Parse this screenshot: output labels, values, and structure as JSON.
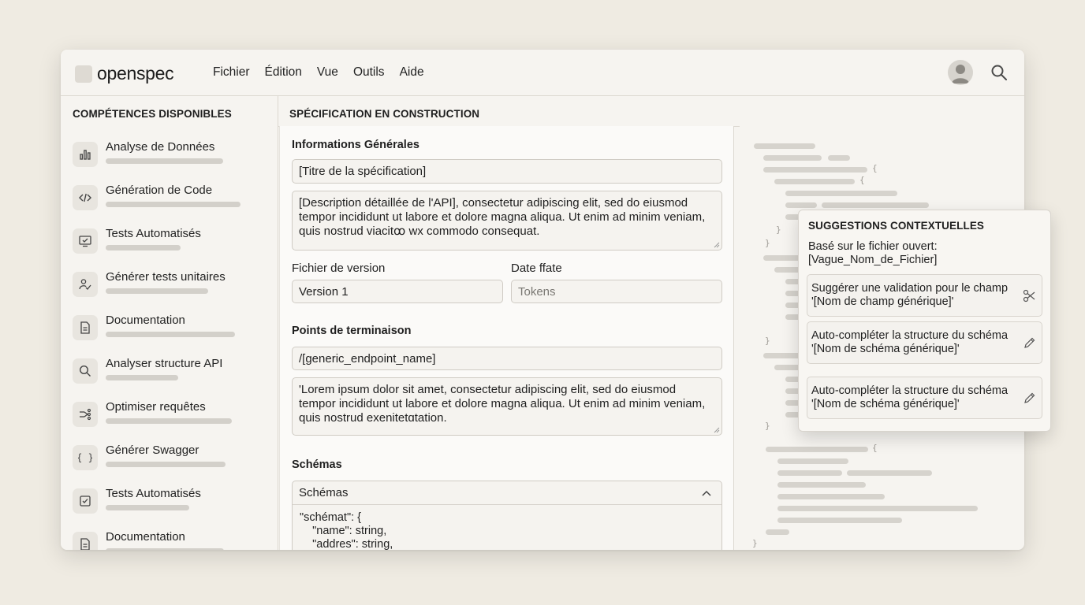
{
  "app": {
    "name": "openspec"
  },
  "menu": [
    "Fichier",
    "Édition",
    "Vue",
    "Outils",
    "Aide"
  ],
  "sidebar": {
    "title": "COMPÉTENCES DISPONIBLES",
    "items": [
      {
        "label": "Analyse de Données",
        "icon": "bar-chart-icon"
      },
      {
        "label": "Génération de Code",
        "icon": "code-icon"
      },
      {
        "label": "Tests Automatisés",
        "icon": "monitor-check-icon"
      },
      {
        "label": "Générer tests unitaires",
        "icon": "user-check-icon"
      },
      {
        "label": "Documentation",
        "icon": "document-icon"
      },
      {
        "label": "Analyser structure API",
        "icon": "search-icon"
      },
      {
        "label": "Optimiser requêtes",
        "icon": "flow-icon"
      },
      {
        "label": "Générer Swagger",
        "icon": "braces-icon"
      },
      {
        "label": "Tests Automatisés",
        "icon": "checkbox-icon"
      },
      {
        "label": "Documentation",
        "icon": "document-icon"
      }
    ]
  },
  "main": {
    "title": "SPÉCIFICATION EN CONSTRUCTION",
    "general": {
      "title": "Informations Générales",
      "spec_title": "[Titre de la spécification]",
      "description": "[Description détaillée de l'API], consectetur adipiscing elit, sed do eiusmod tempor incididunt  ut labore et dolore magna aliqua. Ut enim ad minim veniam, quis nostrud viacitꝏ wx commodo consequat.",
      "version_label": "Fichier de version",
      "version_value": "Version 1",
      "date_label": "Date ffate",
      "date_placeholder": "Tokens"
    },
    "endpoints": {
      "title": "Points de terminaison",
      "path": "/[generic_endpoint_name]",
      "description": "'Lorem ipsum dolor sit amet, consectetur adipiscing elit, sed do eiusmod tempor incididunt ut labore et dolore magna aliqua. Ut enim ad minim veniam, quis nostrud exenitetɑtation."
    },
    "schemas": {
      "title": "Schémas",
      "accordion_label": "Schémas",
      "code": "\"schémat\": {\n    \"name\": string,\n    \"addres\": string,"
    }
  },
  "suggestions": {
    "title": "SUGGESTIONS CONTEXTUELLES",
    "subtitle_line1": "Basé sur le fichier ouvert:",
    "subtitle_line2": "[Vague_Nom_de_Fichier]",
    "items": [
      {
        "line1": "Suggérer une validation pour le champ",
        "line2": "'[Nom de champ générique]'",
        "icon": "scissors-icon"
      },
      {
        "line1": "Auto-compléter la structure du schéma",
        "line2": "'[Nom de schéma générique]'",
        "icon": "pencil-icon"
      },
      {
        "line1": "Auto-compléter la structure du schéma",
        "line2": "'[Nom de schéma générique]'",
        "icon": "pencil-icon"
      }
    ]
  }
}
